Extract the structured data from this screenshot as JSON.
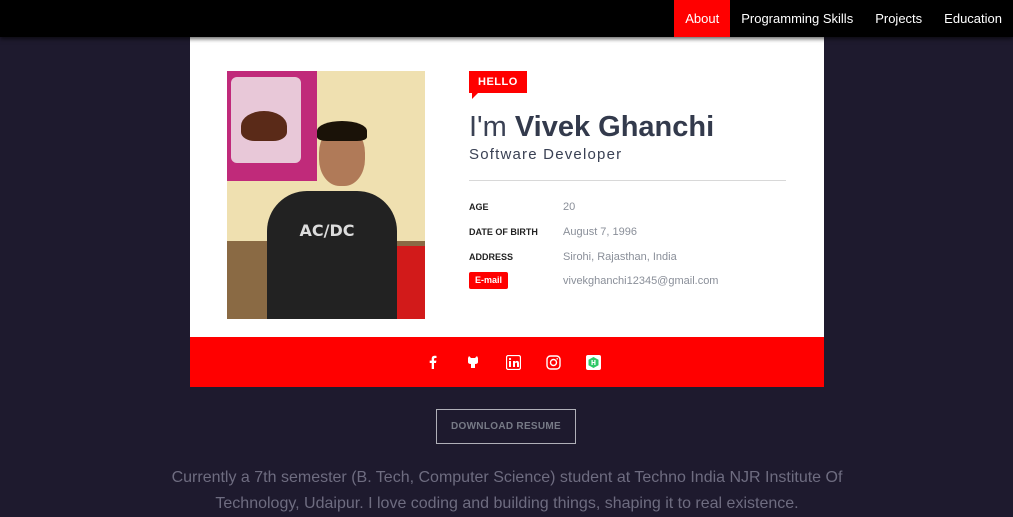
{
  "nav": {
    "items": [
      {
        "label": "About",
        "active": true
      },
      {
        "label": "Programming Skills",
        "active": false
      },
      {
        "label": "Projects",
        "active": false
      },
      {
        "label": "Education",
        "active": false
      }
    ]
  },
  "profile": {
    "badge": "HELLO",
    "greeting": "I'm",
    "name": "Vivek Ghanchi",
    "title": "Software Developer",
    "info": {
      "age_label": "AGE",
      "age_value": "20",
      "dob_label": "DATE OF BIRTH",
      "dob_value": "August 7, 1996",
      "address_label": "ADDRESS",
      "address_value": "Sirohi, Rajasthan, India",
      "email_label": "E-mail",
      "email_value": "vivekghanchi12345@gmail.com"
    }
  },
  "social": {
    "icons": [
      "facebook-icon",
      "github-icon",
      "linkedin-icon",
      "instagram-icon",
      "hackerrank-icon"
    ]
  },
  "resume_button": "DOWNLOAD RESUME",
  "about_text": "Currently a 7th semester (B. Tech, Computer Science) student at Techno India NJR Institute Of Technology, Udaipur. I love coding and building things, shaping it to real existence.",
  "colors": {
    "accent": "#ff0000",
    "background": "#1e1a2e",
    "navbar": "#000000",
    "card": "#ffffff"
  }
}
